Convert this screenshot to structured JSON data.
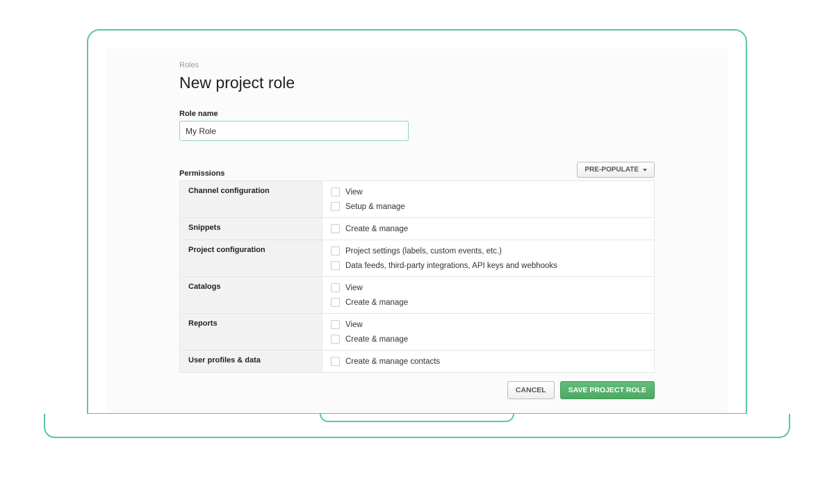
{
  "breadcrumb": "Roles",
  "title": "New project role",
  "roleName": {
    "label": "Role name",
    "value": "My Role"
  },
  "permissions": {
    "label": "Permissions",
    "prePopulateLabel": "PRE-POPULATE",
    "groups": [
      {
        "category": "Channel configuration",
        "options": [
          "View",
          "Setup & manage"
        ]
      },
      {
        "category": "Snippets",
        "options": [
          "Create & manage"
        ]
      },
      {
        "category": "Project configuration",
        "options": [
          "Project settings (labels, custom events, etc.)",
          "Data feeds, third-party integrations, API keys and webhooks"
        ]
      },
      {
        "category": "Catalogs",
        "options": [
          "View",
          "Create & manage"
        ]
      },
      {
        "category": "Reports",
        "options": [
          "View",
          "Create & manage"
        ]
      },
      {
        "category": "User profiles & data",
        "options": [
          "Create & manage contacts"
        ]
      }
    ]
  },
  "actions": {
    "cancel": "CANCEL",
    "save": "SAVE PROJECT ROLE"
  }
}
